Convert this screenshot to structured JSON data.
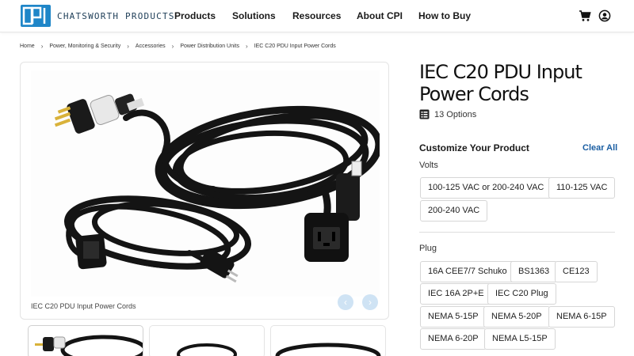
{
  "header": {
    "logo_text": "CHATSWORTH PRODUCTS",
    "nav": [
      "Products",
      "Solutions",
      "Resources",
      "About CPI",
      "How to Buy"
    ],
    "cart_icon": "cart-icon",
    "account_icon": "user-circle-icon"
  },
  "breadcrumb": [
    "Home",
    "Power, Monitoring & Security",
    "Accessories",
    "Power Distribution Units",
    "IEC C20 PDU Input Power Cords"
  ],
  "gallery": {
    "caption": "IEC C20 PDU Input Power Cords",
    "prev_label": "‹",
    "next_label": "›"
  },
  "product": {
    "title": "IEC C20 PDU Input Power Cords",
    "options_count": "13 Options",
    "customize_label": "Customize Your Product",
    "clear_all_label": "Clear All"
  },
  "filters": {
    "volts": {
      "label": "Volts",
      "options": [
        "100-125 VAC or 200-240 VAC",
        "110-125 VAC",
        "200-240 VAC"
      ]
    },
    "plug": {
      "label": "Plug",
      "options": [
        "16A CEE7/7 Schuko",
        "BS1363",
        "CE123",
        "IEC 16A 2P+E",
        "IEC C20 Plug",
        "NEMA 5-15P",
        "NEMA 5-20P",
        "NEMA 6-15P",
        "NEMA 6-20P",
        "NEMA L5-15P"
      ]
    }
  },
  "colors": {
    "brand_blue": "#1f86c8",
    "link_blue": "#1b5fa3",
    "arrow_bg": "#cfe3f4"
  }
}
